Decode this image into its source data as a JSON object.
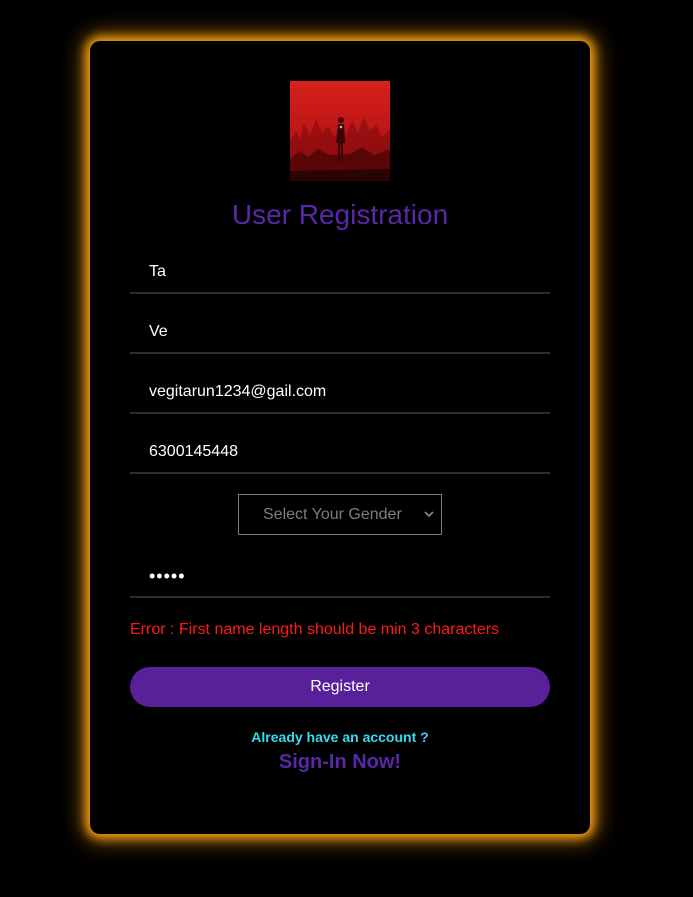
{
  "form": {
    "title": "User Registration",
    "first_name_value": "Ta",
    "last_name_value": "Ve",
    "email_value": "vegitarun1234@gail.com",
    "phone_value": "6300145448",
    "gender_select_label": "Select Your Gender",
    "password_value": "•••••",
    "error_message": "Error : First name length should be min 3 characters",
    "register_label": "Register",
    "already_account_text": "Already have an account ?",
    "signin_link": "Sign-In Now!"
  },
  "logo": {
    "icon": "silhouette-figure-logo-icon"
  },
  "colors": {
    "card_glow": "#f5a312",
    "title": "#5b27a6",
    "error": "#ff1a1a",
    "register_button": "#58219a",
    "already_text": "#33dcef"
  }
}
